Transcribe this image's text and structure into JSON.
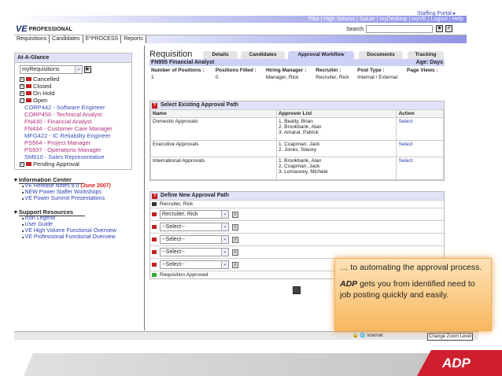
{
  "header": {
    "portal": "Staffing Portal ▸",
    "toplinks": "Pilot | High Volume | Salute | myDesktop | myVE | Logout | Help",
    "logo": "PROFESSIONAL",
    "logo_mark": "VE",
    "search_label": "Search"
  },
  "nav": [
    "Requisitions",
    "Candidates",
    "E*PROCESS",
    "Reports"
  ],
  "sidebar": {
    "glance_title": "At-A-Glance",
    "dropdown": "myRequisitions",
    "folders": {
      "cancelled": "Cancelled",
      "closed": "Closed",
      "onhold": "On Hold",
      "open": "Open",
      "pending": "Pending Approval"
    },
    "reqs": [
      "CORP442 - Software Engineer",
      "CORP450 - Technical Analyst",
      "FN430 - Financial Analyst",
      "FN434 - Customer Care Manager",
      "MFG422 - IC Reliability Engineer",
      "PS564 - Project Manager",
      "PS937 - Operations Manager",
      "SM610 - Sales Representative"
    ],
    "info_title": "Information Center",
    "info_links": [
      "VE Release Notes 8.0",
      "NEW Power Staffer Workshops",
      "VE Power Summit Presentations"
    ],
    "info_date": "(June 2007)",
    "support_title": "Support Resources",
    "support_links": [
      "Icon Legend",
      "User Guide",
      "VE High Volume Functional Overview",
      "VE Professional Functional Overview"
    ]
  },
  "main": {
    "title": "Requisition",
    "tabs": [
      "Details",
      "Candidates",
      "Approval Workflow",
      "Documents",
      "Tracking"
    ],
    "job": "FN955 Financial Analyst",
    "age": "Age: Days",
    "info_headers": [
      "Number of Positions :",
      "Positions Filled :",
      "Hiring Manager :",
      "Recruiter :",
      "Post Type :",
      "Page Views :"
    ],
    "info_values": [
      "1",
      "0",
      "Manager, Rick",
      "Recruiter, Rick",
      "Internal / External",
      ""
    ],
    "existing": {
      "title": "Select Existing Approval Path",
      "headers": [
        "Name",
        "Approver List",
        "Action"
      ],
      "rows": [
        {
          "name": "Domestic Approvals",
          "approvers": [
            "1. Beatty, Brian",
            "2. Brookbank, Alan",
            "3. Amaral, Patrick"
          ],
          "action": "Select"
        },
        {
          "name": "Executive Approvals",
          "approvers": [
            "1. Coapman, Jack",
            "2. Jones, Stacey"
          ],
          "action": "Select"
        },
        {
          "name": "International Approvals",
          "approvers": [
            "1. Brookbank, Alan",
            "2. Coapman, Jack",
            "3. Lomasney, Michele"
          ],
          "action": "Select"
        }
      ]
    },
    "define": {
      "title": "Define New Approval Path",
      "start": "Recruiter, Rick",
      "selects": [
        "Recruiter, Rick",
        "--Select--",
        "--Select--",
        "--Select--",
        "--Select--"
      ],
      "end": "Requisition Approved"
    }
  },
  "status": {
    "zone": "Internet",
    "zoom": "Change Zoom Level"
  },
  "callout": {
    "line1": "… to automating the approval process.",
    "brand": "ADP",
    "line2": " gets you from identified need to job posting quickly and easily."
  },
  "brand_logo": "ADP"
}
